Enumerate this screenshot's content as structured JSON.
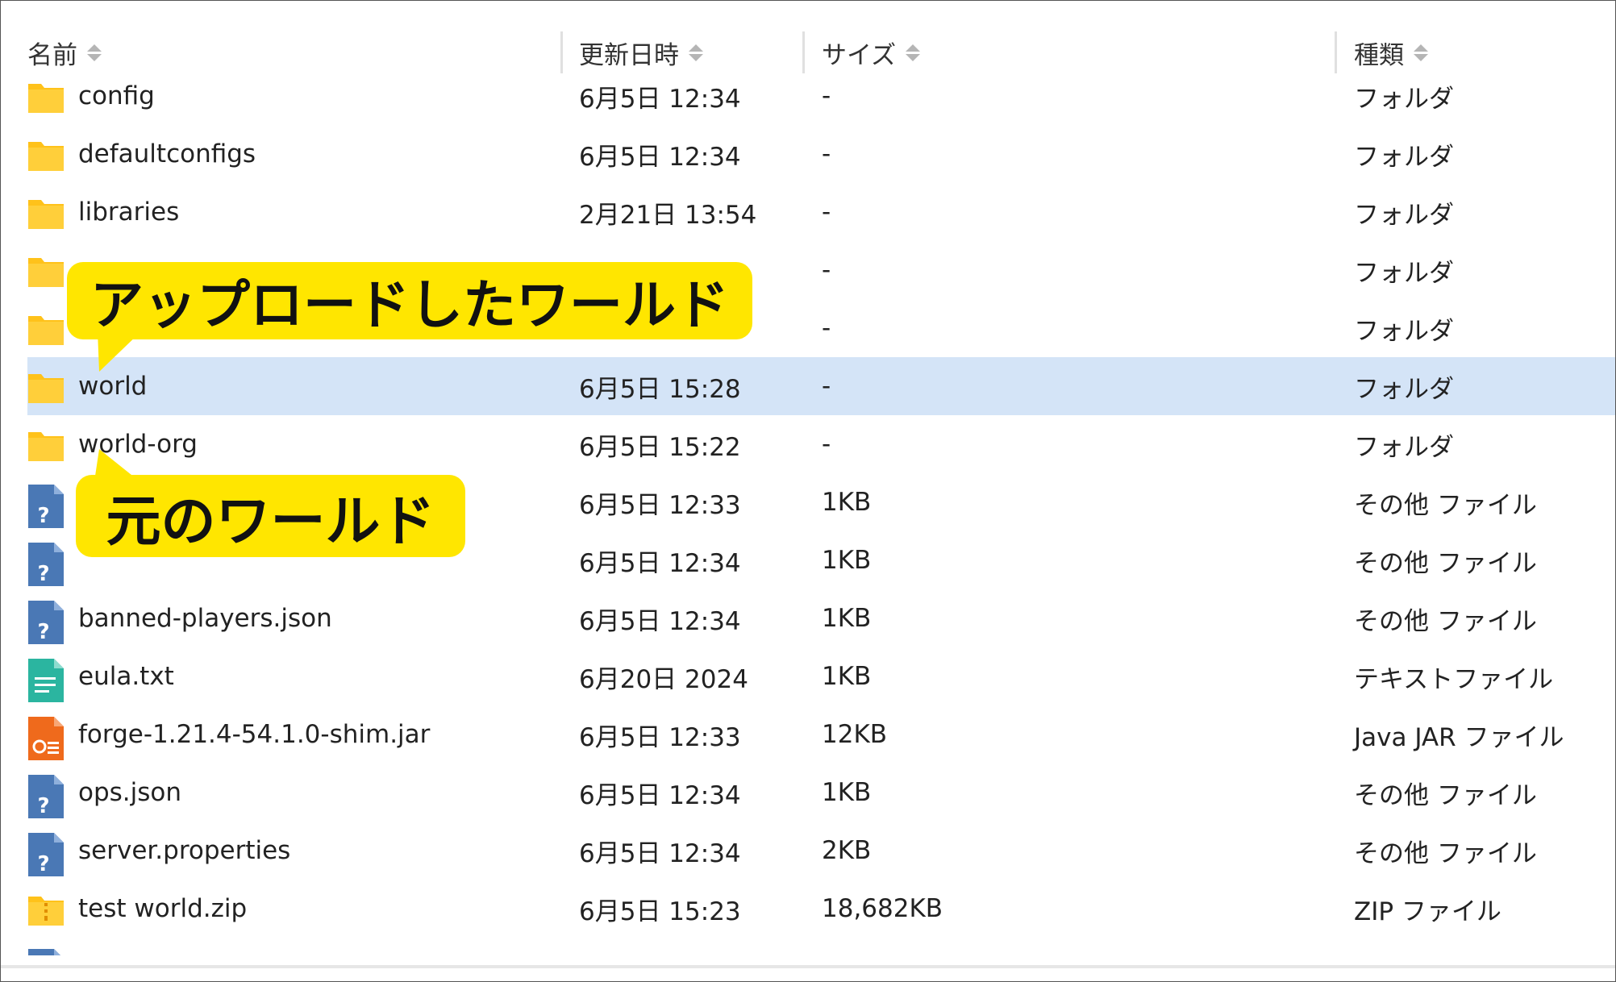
{
  "columns": {
    "name": "名前",
    "date": "更新日時",
    "size": "サイズ",
    "type": "種類"
  },
  "rows": [
    {
      "name": "config",
      "date": "6月5日 12:34",
      "size": "-",
      "type": "フォルダ",
      "icon": "folder-icon"
    },
    {
      "name": "defaultconfigs",
      "date": "6月5日 12:34",
      "size": "-",
      "type": "フォルダ",
      "icon": "folder-icon"
    },
    {
      "name": "libraries",
      "date": "2月21日 13:54",
      "size": "-",
      "type": "フォルダ",
      "icon": "folder-icon"
    },
    {
      "name": "",
      "date": "",
      "size": "-",
      "type": "フォルダ",
      "icon": "folder-icon"
    },
    {
      "name": "",
      "date": "",
      "size": "-",
      "type": "フォルダ",
      "icon": "folder-icon"
    },
    {
      "name": "world",
      "date": "6月5日 15:28",
      "size": "-",
      "type": "フォルダ",
      "icon": "folder-icon",
      "selected": true
    },
    {
      "name": "world-org",
      "date": "6月5日 15:22",
      "size": "-",
      "type": "フォルダ",
      "icon": "folder-icon"
    },
    {
      "name": "",
      "date": "6月5日 12:33",
      "size": "1KB",
      "type": "その他 ファイル",
      "icon": "unknown-file-icon"
    },
    {
      "name": "",
      "date": "6月5日 12:34",
      "size": "1KB",
      "type": "その他 ファイル",
      "icon": "unknown-file-icon"
    },
    {
      "name": "banned-players.json",
      "date": "6月5日 12:34",
      "size": "1KB",
      "type": "その他 ファイル",
      "icon": "unknown-file-icon"
    },
    {
      "name": "eula.txt",
      "date": "6月20日 2024",
      "size": "1KB",
      "type": "テキストファイル",
      "icon": "text-file-icon"
    },
    {
      "name": "forge-1.21.4-54.1.0-shim.jar",
      "date": "6月5日 12:33",
      "size": "12KB",
      "type": "Java JAR ファイル",
      "icon": "jar-file-icon"
    },
    {
      "name": "ops.json",
      "date": "6月5日 12:34",
      "size": "1KB",
      "type": "その他 ファイル",
      "icon": "unknown-file-icon"
    },
    {
      "name": "server.properties",
      "date": "6月5日 12:34",
      "size": "2KB",
      "type": "その他 ファイル",
      "icon": "unknown-file-icon"
    },
    {
      "name": "test world.zip",
      "date": "6月5日 15:23",
      "size": "18,682KB",
      "type": "ZIP ファイル",
      "icon": "zip-file-icon"
    },
    {
      "name": "",
      "date": "",
      "size": "",
      "type": "",
      "icon": "unknown-file-icon"
    }
  ],
  "callouts": {
    "uploaded": "アップロードしたワールド",
    "original": "元のワールド"
  },
  "colors": {
    "folder": "#ffc21a",
    "selected_row": "#d4e4f7",
    "callout": "#ffe600",
    "unknown_file": "#4a78b5",
    "text_file": "#2bb5a0",
    "jar_file": "#ef6a1c"
  }
}
